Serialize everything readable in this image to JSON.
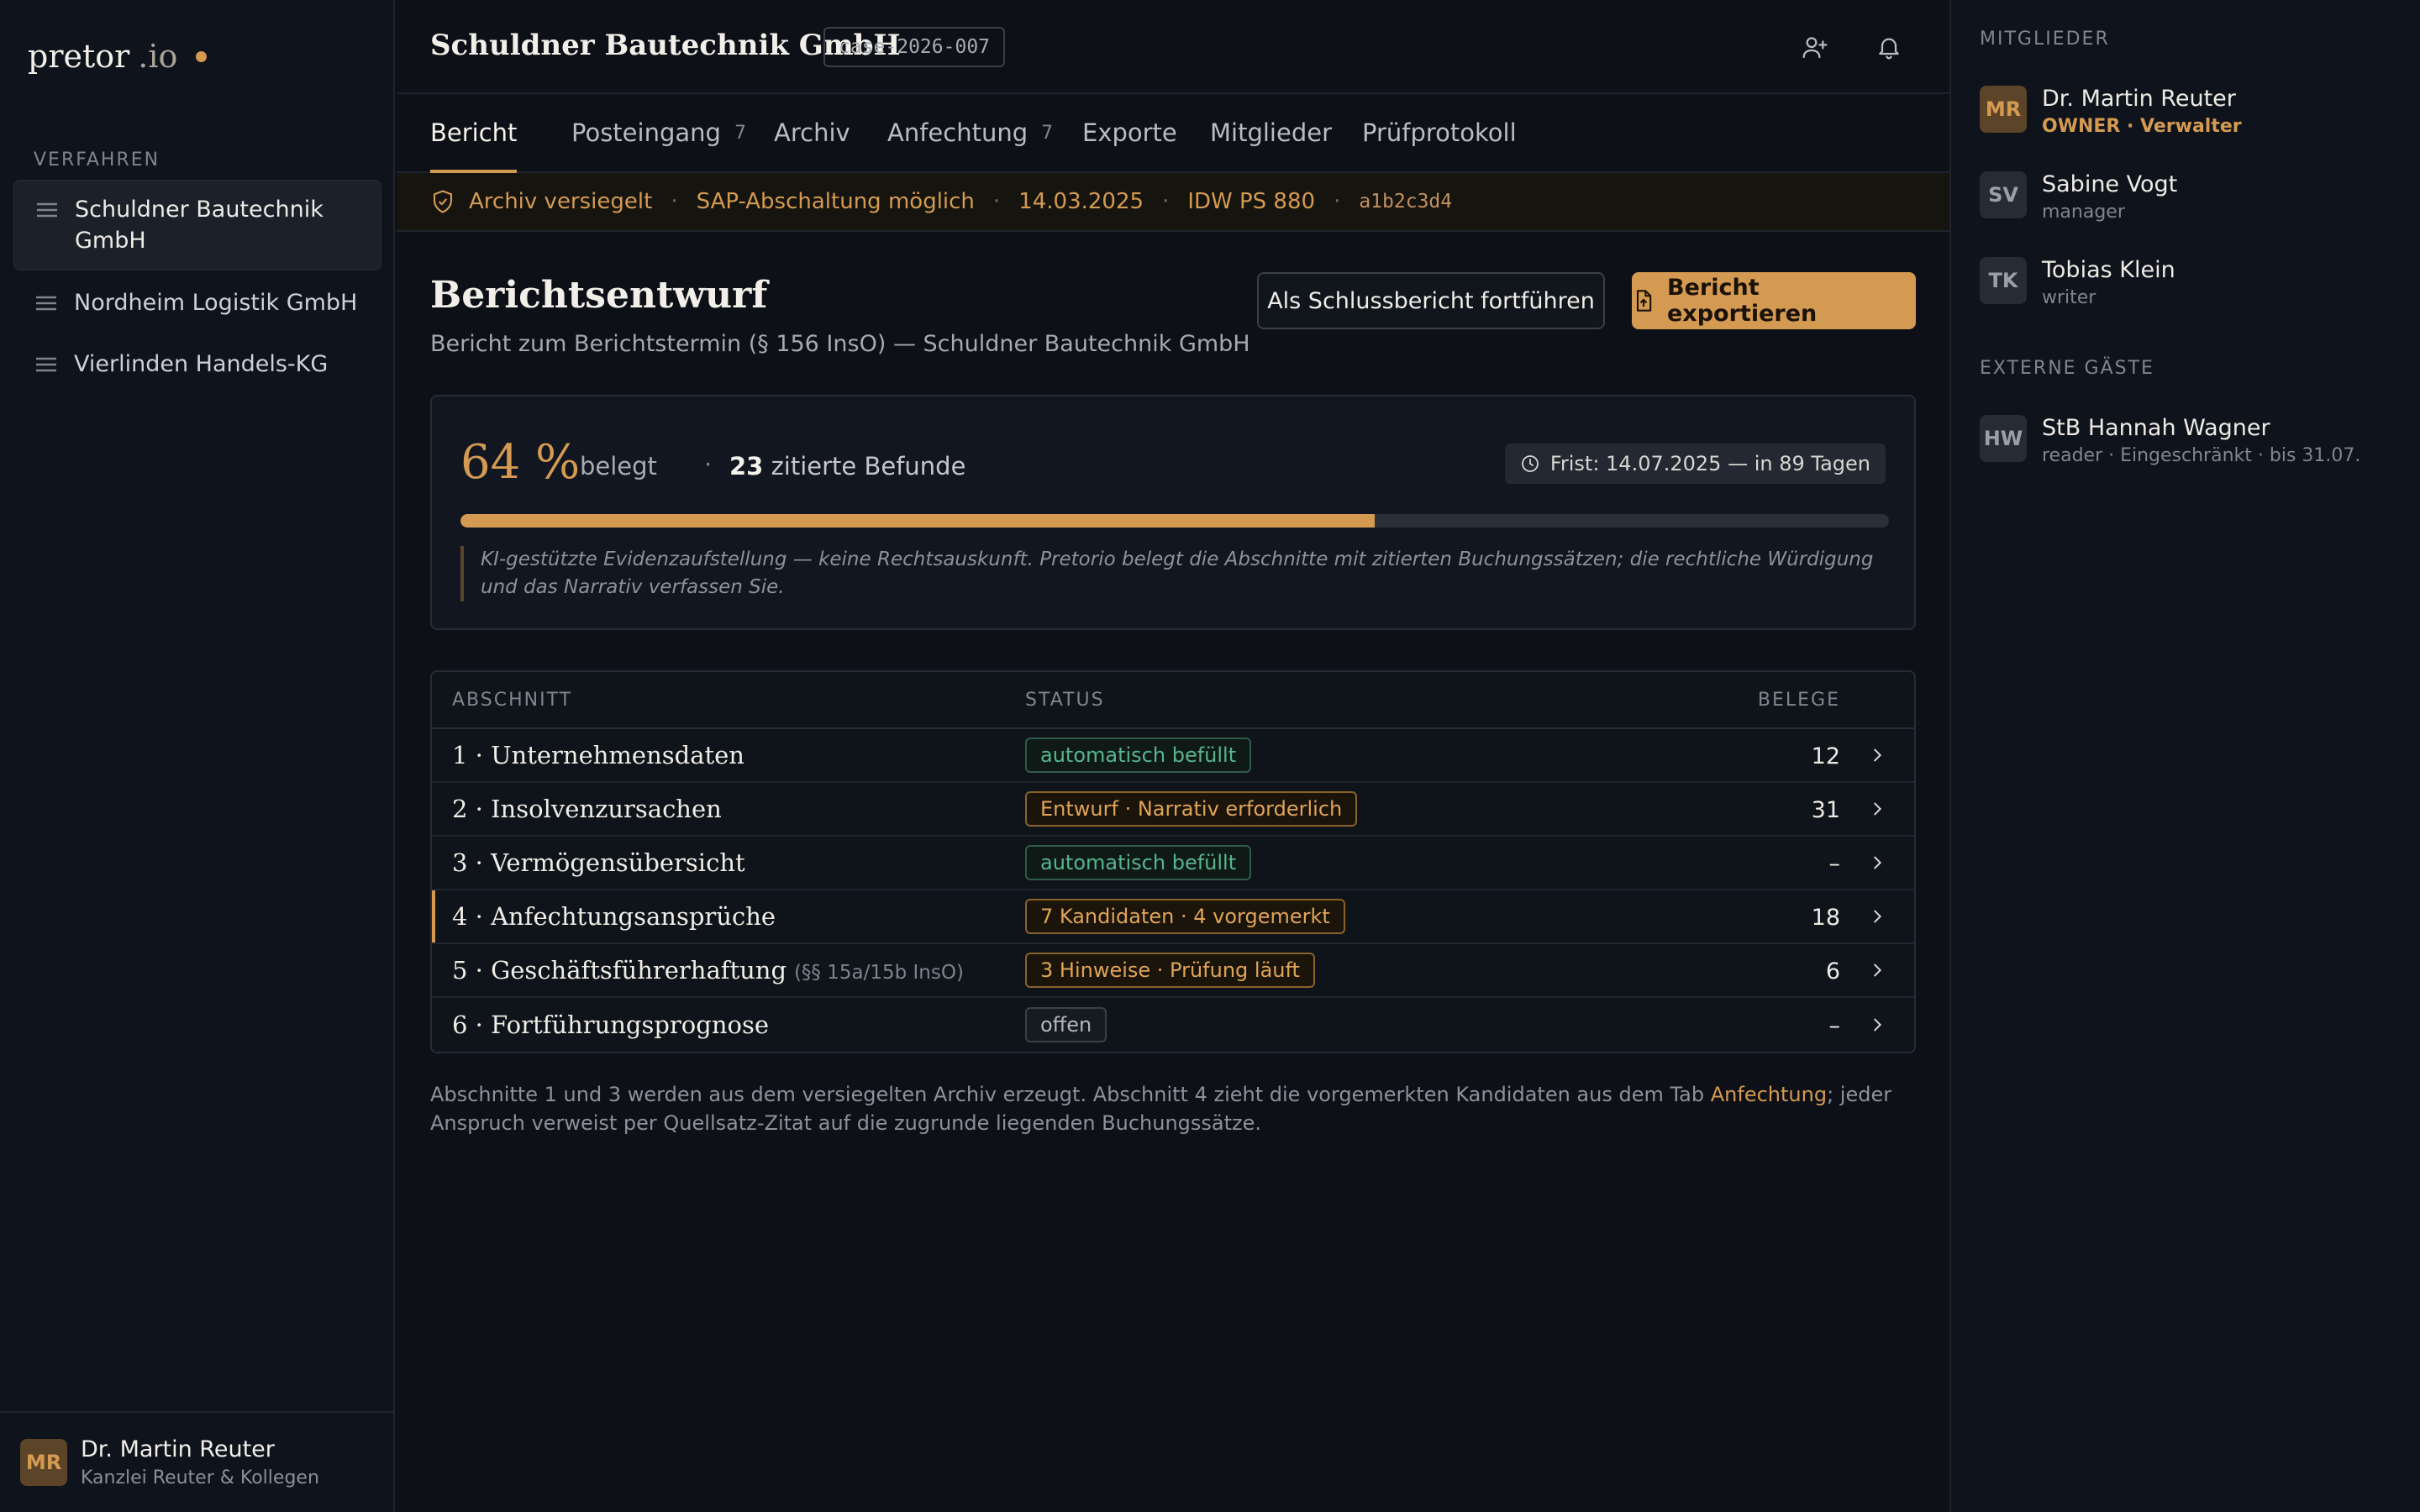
{
  "brand": {
    "name": "pretor",
    "suffix": ".io"
  },
  "sidebar": {
    "section_label": "VERFAHREN",
    "items": [
      {
        "label": "Schuldner Bautechnik GmbH",
        "active": true
      },
      {
        "label": "Nordheim Logistik GmbH",
        "active": false
      },
      {
        "label": "Vierlinden Handels-KG",
        "active": false
      }
    ],
    "user": {
      "initials": "MR",
      "name": "Dr. Martin Reuter",
      "org": "Kanzlei Reuter & Kollegen"
    }
  },
  "header": {
    "title": "Schuldner Bautechnik GmbH",
    "case_id": "case-2026-007",
    "icons": [
      "add-user-icon",
      "bell-icon"
    ]
  },
  "tabs": [
    {
      "label": "Bericht",
      "count": "",
      "active": true
    },
    {
      "label": "Posteingang",
      "count": "7",
      "active": false
    },
    {
      "label": "Archiv",
      "count": "",
      "active": false
    },
    {
      "label": "Anfechtung",
      "count": "7",
      "active": false
    },
    {
      "label": "Exporte",
      "count": "",
      "active": false
    },
    {
      "label": "Mitglieder",
      "count": "",
      "active": false
    },
    {
      "label": "Prüfprotokoll",
      "count": "",
      "active": false
    }
  ],
  "banner": {
    "seal": "Archiv versiegelt",
    "sap": "SAP-Abschaltung möglich",
    "date": "14.03.2025",
    "standard": "IDW PS 880",
    "hash": "a1b2c3d4"
  },
  "report": {
    "title": "Berichtsentwurf",
    "subtitle": "Bericht zum Berichtstermin (§ 156 InsO) — Schuldner Bautechnik GmbH",
    "btn_continue": "Als Schlussbericht fortführen",
    "btn_export": "Bericht exportieren"
  },
  "stats": {
    "percent_text": "64 %",
    "percent_value": 64,
    "percent_label": "belegt",
    "separator": "·",
    "findings_count": "23",
    "findings_label": "zitierte Befunde",
    "deadline": "Frist: 14.07.2025 — in 89 Tagen",
    "disclaimer": "KI-gestützte Evidenzaufstellung — keine Rechtsauskunft. Pretorio belegt die Abschnitte mit zitierten Buchungssätzen; die rechtliche Würdigung und das Narrativ verfassen Sie."
  },
  "table": {
    "headers": {
      "section": "ABSCHNITT",
      "status": "STATUS",
      "evidence": "BELEGE"
    },
    "rows": [
      {
        "section": "1 · Unternehmensdaten",
        "note": "",
        "status": "automatisch befüllt",
        "tone": "green",
        "count": "12",
        "highlight": false
      },
      {
        "section": "2 · Insolvenzursachen",
        "note": "",
        "status": "Entwurf · Narrativ erforderlich",
        "tone": "amber",
        "count": "31",
        "highlight": false
      },
      {
        "section": "3 · Vermögensübersicht",
        "note": "",
        "status": "automatisch befüllt",
        "tone": "green",
        "count": "–",
        "highlight": false
      },
      {
        "section": "4 · Anfechtungsansprüche",
        "note": "",
        "status": "7 Kandidaten · 4 vorgemerkt",
        "tone": "amber",
        "count": "18",
        "highlight": true
      },
      {
        "section": "5 · Geschäftsführerhaftung",
        "note": "(§§ 15a/15b InsO)",
        "status": "3 Hinweise · Prüfung läuft",
        "tone": "amber",
        "count": "6",
        "highlight": false
      },
      {
        "section": "6 · Fortführungsprognose",
        "note": "",
        "status": "offen",
        "tone": "grey",
        "count": "–",
        "highlight": false
      }
    ]
  },
  "footnote": {
    "before": "Abschnitte 1 und 3 werden aus dem versiegelten Archiv erzeugt. Abschnitt 4 zieht die vorgemerkten Kandidaten aus dem Tab ",
    "link": "Anfechtung",
    "after": "; jeder Anspruch verweist per Quellsatz-Zitat auf die zugrunde liegenden Buchungssätze."
  },
  "members": {
    "label": "MITGLIEDER",
    "list": [
      {
        "initials": "MR",
        "name": "Dr. Martin Reuter",
        "role": "OWNER · Verwalter",
        "owner": true
      },
      {
        "initials": "SV",
        "name": "Sabine Vogt",
        "role": "manager",
        "owner": false
      },
      {
        "initials": "TK",
        "name": "Tobias Klein",
        "role": "writer",
        "owner": false
      }
    ]
  },
  "guests": {
    "label": "EXTERNE GÄSTE",
    "list": [
      {
        "initials": "HW",
        "name": "StB Hannah Wagner",
        "role": "reader · Eingeschränkt · bis 31.07."
      }
    ]
  },
  "colors": {
    "accent": "#d49a52",
    "background": "#0d1017",
    "success": "#58b48e"
  }
}
